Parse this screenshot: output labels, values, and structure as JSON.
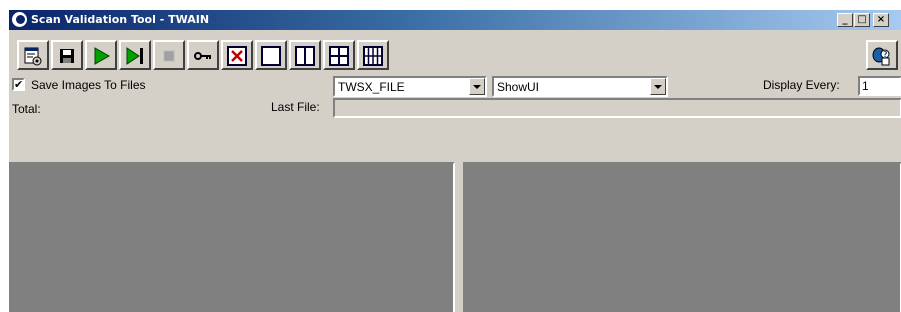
{
  "window": {
    "title": "Scan Validation Tool - TWAIN"
  },
  "titlebar_buttons": {
    "minimize": "_",
    "maximize": "□",
    "close": "×"
  },
  "toolbar": {
    "buttons": [
      {
        "name": "settings-button",
        "icon": "settings-icon"
      },
      {
        "name": "save-button",
        "icon": "floppy-disk-icon"
      },
      {
        "name": "start-button",
        "icon": "play-icon"
      },
      {
        "name": "single-page-button",
        "icon": "play-step-icon"
      },
      {
        "name": "stop-button",
        "icon": "stop-icon"
      },
      {
        "name": "licence-key-button",
        "icon": "key-icon"
      },
      {
        "name": "view-none-button",
        "icon": "no-view-icon"
      },
      {
        "name": "view-single-button",
        "icon": "single-pane-icon"
      },
      {
        "name": "view-dual-button",
        "icon": "dual-pane-icon"
      },
      {
        "name": "view-quad-button",
        "icon": "quad-pane-icon"
      },
      {
        "name": "view-eight-button",
        "icon": "eight-pane-icon"
      }
    ],
    "help_icon": "help-person-icon"
  },
  "options": {
    "save_images_label": "Save Images To Files",
    "save_images_checked": true,
    "check_glyph": "✔",
    "file_format": "TWSX_FILE",
    "ui_mode": "ShowUI",
    "display_every_label": "Display Every:",
    "display_every_value": "1"
  },
  "status": {
    "total_label": "Total:",
    "last_file_label": "Last File:",
    "last_file_value": ""
  },
  "colors": {
    "pane": "#808080",
    "face": "#d4d0c8",
    "title_start": "#0a246a",
    "title_end": "#a6caf0"
  }
}
